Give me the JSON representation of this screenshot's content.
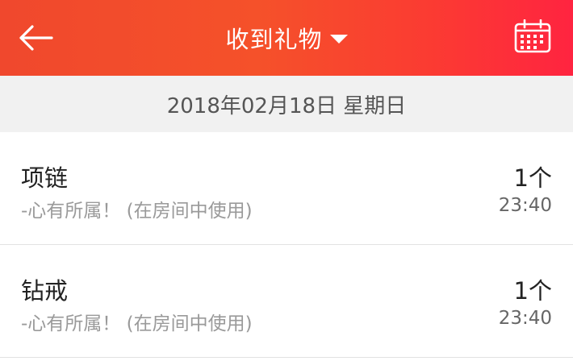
{
  "header": {
    "title": "收到礼物",
    "back_icon": "arrow-left-icon",
    "dropdown_icon": "caret-down-icon",
    "calendar_icon": "calendar-icon"
  },
  "date_bar": {
    "date": "2018年02月18日 星期日"
  },
  "gifts": [
    {
      "name": "项链",
      "description": "-心有所属！ (在房间中使用)",
      "count": "1个",
      "time": "23:40"
    },
    {
      "name": "钻戒",
      "description": "-心有所属！ (在房间中使用)",
      "count": "1个",
      "time": "23:40"
    }
  ],
  "colors": {
    "header_start": "#f0482d",
    "header_end": "#ff2440",
    "date_bar_bg": "#f1f1f1"
  }
}
